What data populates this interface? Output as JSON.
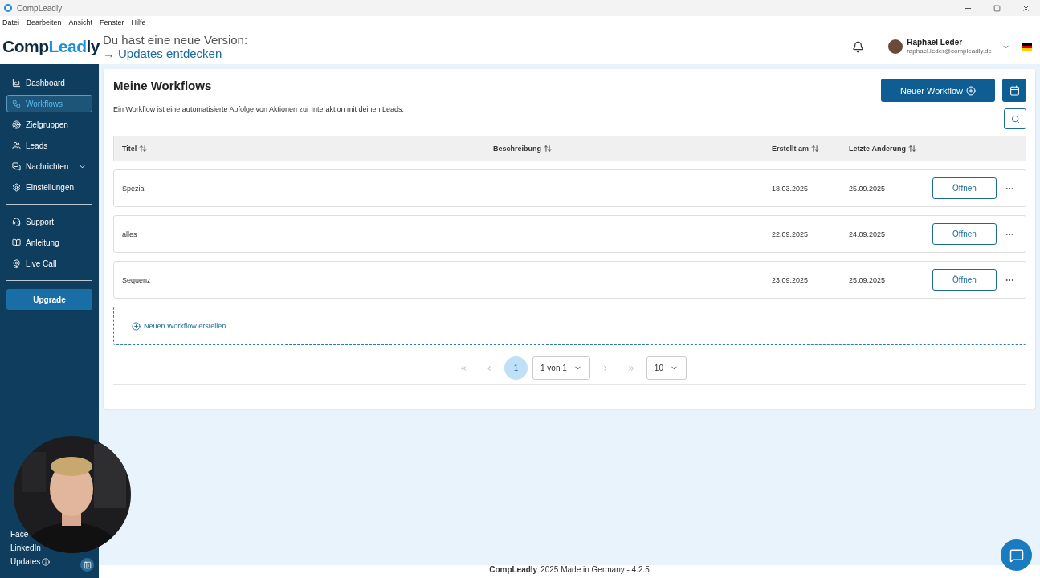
{
  "window": {
    "title": "CompLeadly"
  },
  "menu": [
    "Datei",
    "Bearbeiten",
    "Ansicht",
    "Fenster",
    "Hilfe"
  ],
  "header": {
    "logo_parts": [
      "Comp",
      "Lead",
      "ly"
    ],
    "update_notice": "Du hast eine neue Version:",
    "update_arrow": "→",
    "update_link": "Updates entdecken",
    "user_name": "Raphael Leder",
    "user_email": "raphael.leder@compleadly.de"
  },
  "sidebar": {
    "items": [
      {
        "label": "Dashboard",
        "selected": false,
        "expandable": false
      },
      {
        "label": "Workflows",
        "selected": true,
        "expandable": false
      },
      {
        "label": "Zielgruppen",
        "selected": false,
        "expandable": false
      },
      {
        "label": "Leads",
        "selected": false,
        "expandable": false
      },
      {
        "label": "Nachrichten",
        "selected": false,
        "expandable": true
      },
      {
        "label": "Einstellungen",
        "selected": false,
        "expandable": false
      }
    ],
    "help_items": [
      {
        "label": "Support",
        "selected": false
      },
      {
        "label": "Anleitung",
        "selected": false
      },
      {
        "label": "Live Call",
        "selected": false
      }
    ],
    "upgrade": "Upgrade",
    "links": [
      {
        "label": "Face",
        "info": false
      },
      {
        "label": "LinkedIn",
        "info": false
      },
      {
        "label": "Updates",
        "info": true
      }
    ]
  },
  "page": {
    "title": "Meine Workflows",
    "description": "Ein Workflow ist eine automatisierte Abfolge von Aktionen zur Interaktion mit deinen Leads.",
    "new_button": "Neuer Workflow",
    "columns": [
      "Titel",
      "Beschreibung",
      "Erstellt am",
      "Letzte Änderung"
    ],
    "rows": [
      {
        "title": "Spezial",
        "created": "18.03.2025",
        "modified": "25.09.2025",
        "action": "Öffnen"
      },
      {
        "title": "alles",
        "created": "22.09.2025",
        "modified": "24.09.2025",
        "action": "Öffnen"
      },
      {
        "title": "Sequenz",
        "created": "23.09.2025",
        "modified": "25.09.2025",
        "action": "Öffnen"
      }
    ],
    "add_row": "Neuen Workflow erstellen",
    "pagination": {
      "current": "1",
      "page_select": "1 von 1",
      "page_size": "10"
    }
  },
  "webcam": {
    "kind": "picture"
  },
  "footer": {
    "brand": "CompLeadly",
    "text": "2025 Made in Germany - 4.2.5"
  }
}
